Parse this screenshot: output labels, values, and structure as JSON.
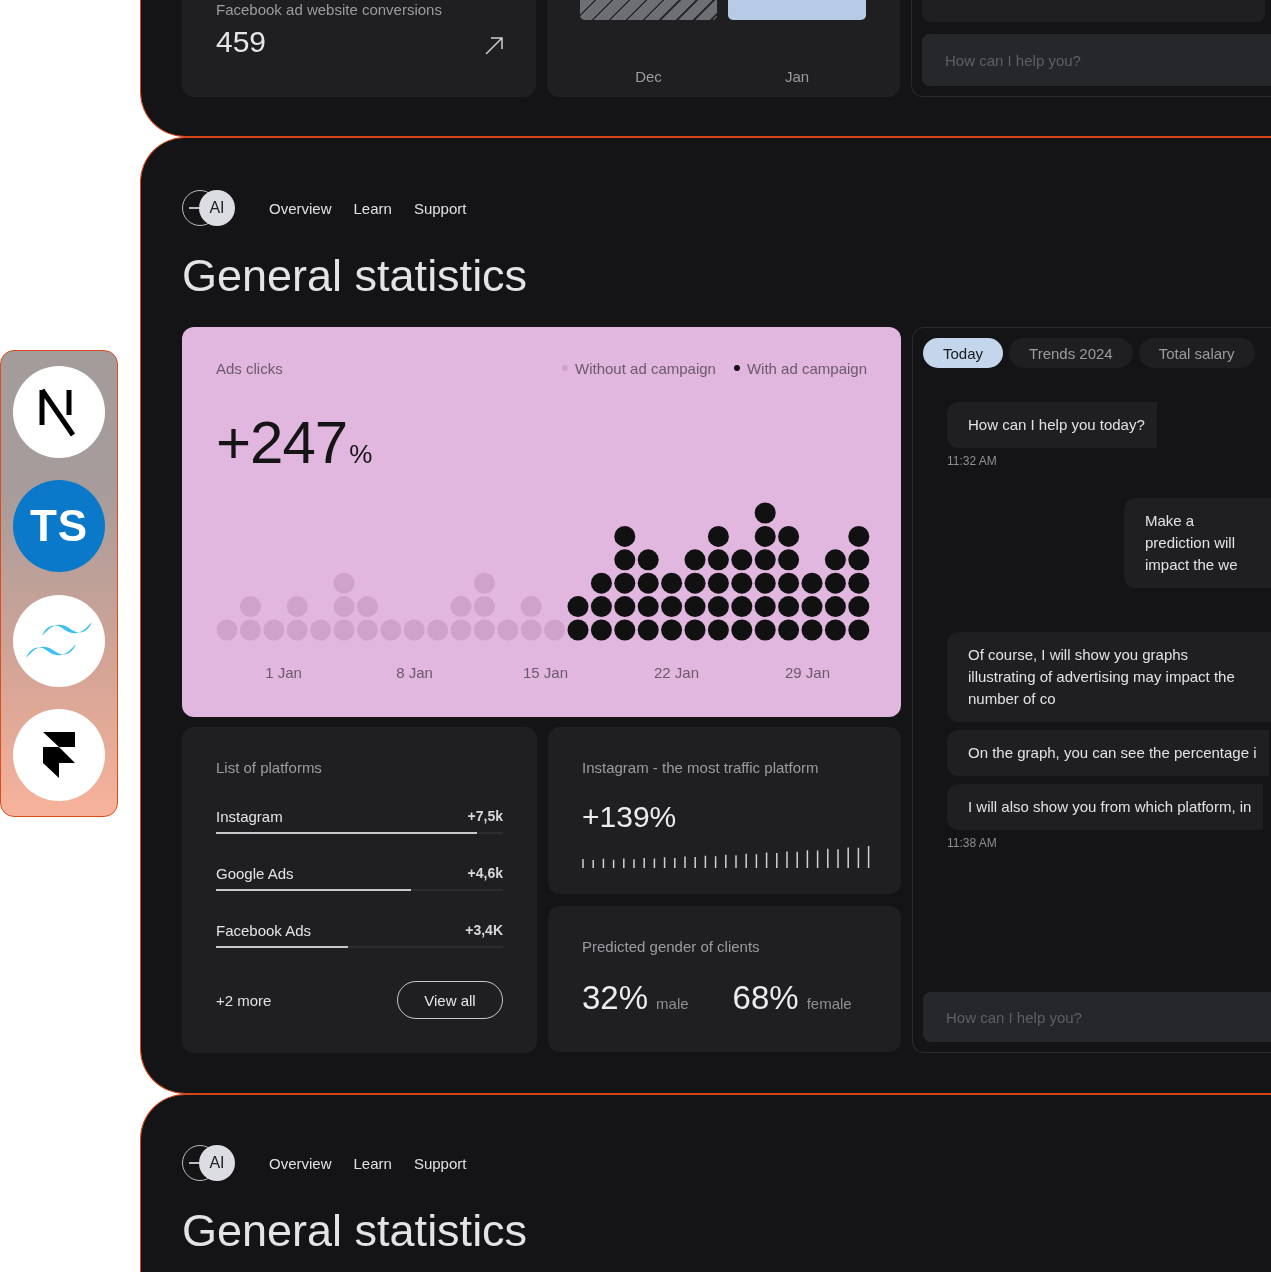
{
  "tool_logos": [
    {
      "kind": "next"
    },
    {
      "kind": "badge",
      "label": "TS"
    },
    {
      "kind": "waves"
    },
    {
      "kind": "framer"
    }
  ],
  "previous_panel": {
    "stat_card": {
      "label": "Facebook ad website conversions",
      "value": "459"
    },
    "bar_card": {
      "labels": [
        "Dec",
        "Jan"
      ]
    },
    "chat_input": {
      "placeholder": "How can I help you?"
    }
  },
  "dashboard": {
    "nav": {
      "logo": "AI",
      "links": [
        "Overview",
        "Learn",
        "Support"
      ]
    },
    "title": "General statistics",
    "ads_card": {
      "title": "Ads clicks",
      "headline": "+247",
      "unit": "%",
      "legend": [
        {
          "label": "Without ad campaign",
          "color": "#cfa2cc"
        },
        {
          "label": "With ad campaign",
          "color": "#111111"
        }
      ],
      "date_labels": [
        "1 Jan",
        "8 Jan",
        "15 Jan",
        "22 Jan",
        "29 Jan"
      ]
    },
    "platforms": {
      "title": "List of platforms",
      "items": [
        {
          "name": "Instagram",
          "value": "+7,5k",
          "level": 0.91
        },
        {
          "name": "Google Ads",
          "value": "+4,6k",
          "level": 0.68
        },
        {
          "name": "Facebook Ads",
          "value": "+3,4K",
          "level": 0.46
        }
      ],
      "more": "+2 more",
      "button": "View all"
    },
    "top_platform": {
      "title": "Instagram - the most traffic platform",
      "value": "+139%"
    },
    "gender": {
      "title": "Predicted gender of clients",
      "items": [
        {
          "value": "32%",
          "label": "male"
        },
        {
          "value": "68%",
          "label": "female"
        }
      ]
    },
    "chat": {
      "tabs": [
        {
          "label": "Today",
          "selected": true
        },
        {
          "label": "Trends 2024",
          "selected": false
        },
        {
          "label": "Total salary",
          "selected": false
        }
      ],
      "messages": [
        {
          "kind": "bot",
          "text": "How can I help you today?"
        },
        {
          "kind": "time",
          "text": "11:32 AM"
        },
        {
          "kind": "user",
          "text": "Make a prediction will impact the we"
        },
        {
          "kind": "bot",
          "text": "Of course, I will show you graphs illustrating of advertising may impact the number of co"
        },
        {
          "kind": "bot",
          "text": "On the graph, you can see the percentage i"
        },
        {
          "kind": "bot",
          "text": "I will also show you from which platform, in"
        },
        {
          "kind": "time",
          "text": "11:38 AM"
        }
      ],
      "input": {
        "placeholder": "How can I help you?"
      }
    }
  },
  "next_panel": {
    "nav": {
      "logo": "AI",
      "links": [
        "Overview",
        "Learn",
        "Support"
      ]
    },
    "title": "General statistics"
  }
}
